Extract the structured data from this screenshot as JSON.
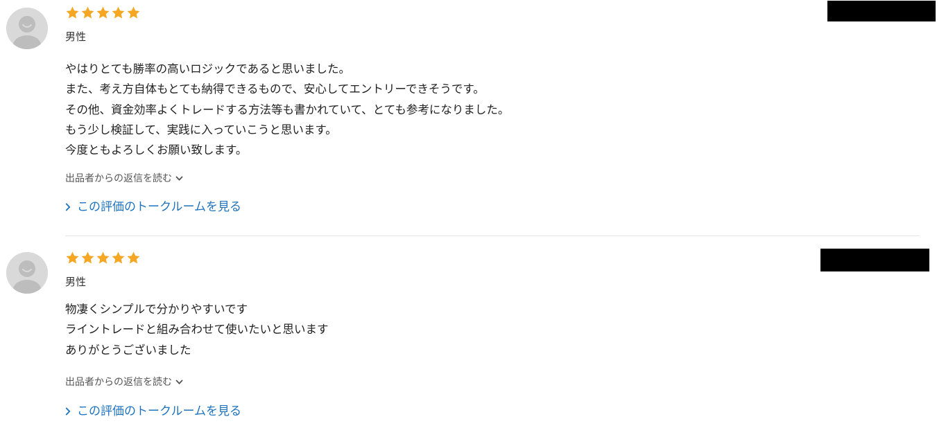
{
  "reviews": [
    {
      "rating": 5,
      "rating_max": 5,
      "gender": "男性",
      "body": [
        "やはりとても勝率の高いロジックであると思いました。",
        "また、考え方自体もとても納得できるもので、安心してエントリーできそうです。",
        "その他、資金効率よくトレードする方法等も書かれていて、とても参考になりました。",
        "もう少し検証して、実践に入っていこうと思います。",
        "今度ともよろしくお願い致します。"
      ],
      "reply_toggle_label": "出品者からの返信を読む",
      "talk_link_label": "この評価のトークルームを見る"
    },
    {
      "rating": 5,
      "rating_max": 5,
      "gender": "男性",
      "body": [
        "物凄くシンプルで分かりやすいです",
        "ライントレードと組み合わせて使いたいと思います",
        "ありがとうございました"
      ],
      "reply_toggle_label": "出品者からの返信を読む",
      "talk_link_label": "この評価のトークルームを見る"
    }
  ],
  "icons": {
    "avatar": "default-avatar-icon",
    "star": "star-icon",
    "reply_chevron": "chevron-down-icon",
    "talk_chevron": "chevron-right-icon"
  },
  "colors": {
    "star": "#f5a623",
    "link": "#1e73be",
    "avatar_bg": "#d9d9d9",
    "avatar_fg": "#b7b7b7",
    "redaction": "#000000"
  }
}
